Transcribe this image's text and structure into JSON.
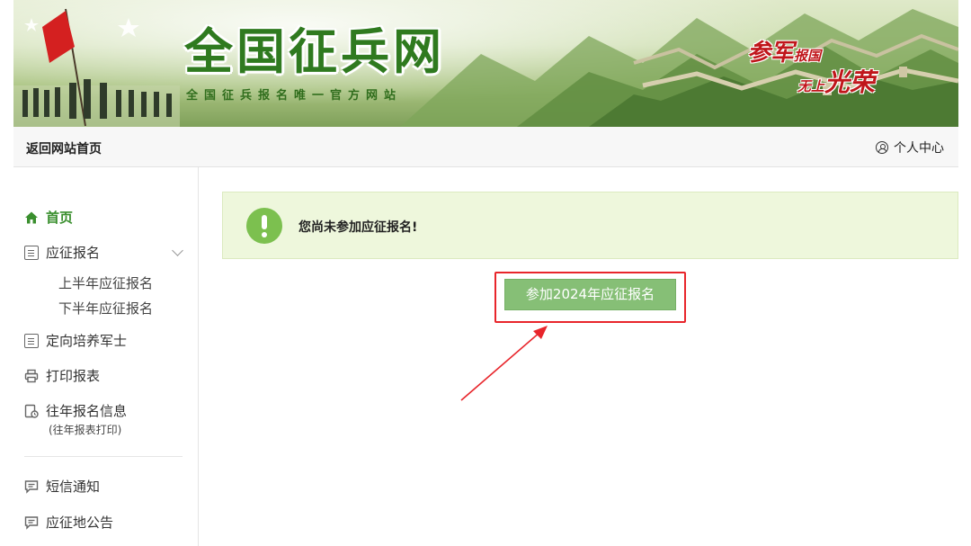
{
  "banner": {
    "title": "全国征兵网",
    "subtitle": "全国征兵报名唯一官方网站",
    "slogan_line1_big": "参军",
    "slogan_line1_small": "报国",
    "slogan_line2_small": "无上",
    "slogan_line2_big": "光荣"
  },
  "topbar": {
    "home_link": "返回网站首页",
    "user_center": "个人中心"
  },
  "sidebar": {
    "items": [
      {
        "label": "首页",
        "icon": "home-icon",
        "active": true
      },
      {
        "label": "应征报名",
        "icon": "document-icon",
        "expanded": true,
        "children": [
          "上半年应征报名",
          "下半年应征报名"
        ]
      },
      {
        "label": "定向培养军士",
        "icon": "document-icon"
      },
      {
        "label": "打印报表",
        "icon": "printer-icon"
      },
      {
        "label": "往年报名信息",
        "icon": "history-icon",
        "note": "(往年报表打印)"
      },
      {
        "label": "短信通知",
        "icon": "message-icon"
      },
      {
        "label": "应征地公告",
        "icon": "message-icon"
      }
    ]
  },
  "main": {
    "alert_message": "您尚未参加应征报名!",
    "apply_button": "参加2024年应征报名"
  },
  "colors": {
    "accent_green": "#3a8f2e",
    "button_green": "#86bf76",
    "alert_bg": "#eef7dc",
    "highlight_red": "#e8252b"
  }
}
